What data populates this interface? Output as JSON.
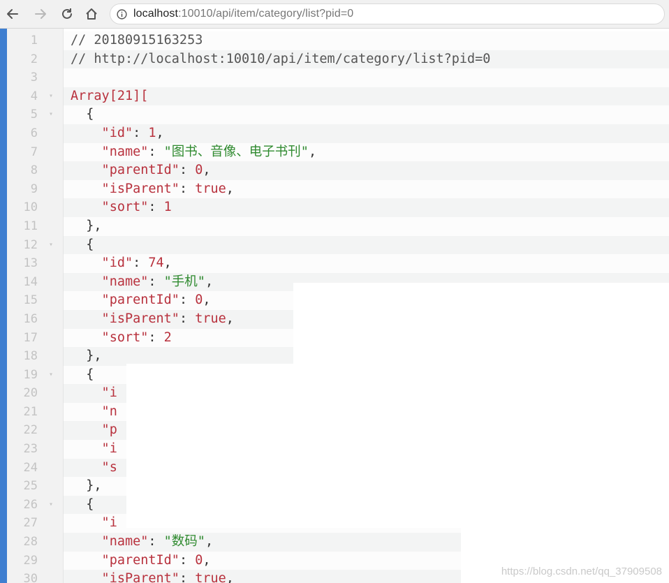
{
  "browser": {
    "url_host": "localhost",
    "url_rest": ":10010/api/item/category/list?pid=0",
    "icons": [
      "back-arrow-icon",
      "forward-arrow-icon",
      "reload-icon",
      "home-icon",
      "info-icon"
    ]
  },
  "viewer": {
    "lines": [
      {
        "n": "1",
        "fold": "",
        "parts": [
          {
            "t": "// 20180915163253",
            "c": "comment"
          }
        ]
      },
      {
        "n": "2",
        "fold": "",
        "parts": [
          {
            "t": "// http://localhost:10010/api/item/category/list?pid=0",
            "c": "comment"
          }
        ]
      },
      {
        "n": "3",
        "fold": "",
        "parts": []
      },
      {
        "n": "4",
        "fold": "▾",
        "parts": [
          {
            "t": "Array",
            "c": "type"
          },
          {
            "t": "[21][",
            "c": "type"
          }
        ]
      },
      {
        "n": "5",
        "fold": "▾",
        "parts": [
          {
            "t": "  {",
            "c": "punct"
          }
        ]
      },
      {
        "n": "6",
        "fold": "",
        "parts": [
          {
            "t": "    \"id\"",
            "c": "key"
          },
          {
            "t": ": ",
            "c": "punct"
          },
          {
            "t": "1",
            "c": "num"
          },
          {
            "t": ",",
            "c": "punct"
          }
        ]
      },
      {
        "n": "7",
        "fold": "",
        "parts": [
          {
            "t": "    \"name\"",
            "c": "key"
          },
          {
            "t": ": ",
            "c": "punct"
          },
          {
            "t": "\"图书、音像、电子书刊\"",
            "c": "str"
          },
          {
            "t": ",",
            "c": "punct"
          }
        ]
      },
      {
        "n": "8",
        "fold": "",
        "parts": [
          {
            "t": "    \"parentId\"",
            "c": "key"
          },
          {
            "t": ": ",
            "c": "punct"
          },
          {
            "t": "0",
            "c": "num"
          },
          {
            "t": ",",
            "c": "punct"
          }
        ]
      },
      {
        "n": "9",
        "fold": "",
        "parts": [
          {
            "t": "    \"isParent\"",
            "c": "key"
          },
          {
            "t": ": ",
            "c": "punct"
          },
          {
            "t": "true",
            "c": "bool"
          },
          {
            "t": ",",
            "c": "punct"
          }
        ]
      },
      {
        "n": "10",
        "fold": "",
        "parts": [
          {
            "t": "    \"sort\"",
            "c": "key"
          },
          {
            "t": ": ",
            "c": "punct"
          },
          {
            "t": "1",
            "c": "num"
          }
        ]
      },
      {
        "n": "11",
        "fold": "",
        "parts": [
          {
            "t": "  },",
            "c": "punct"
          }
        ]
      },
      {
        "n": "12",
        "fold": "▾",
        "parts": [
          {
            "t": "  {",
            "c": "punct"
          }
        ]
      },
      {
        "n": "13",
        "fold": "",
        "parts": [
          {
            "t": "    \"id\"",
            "c": "key"
          },
          {
            "t": ": ",
            "c": "punct"
          },
          {
            "t": "74",
            "c": "num"
          },
          {
            "t": ",",
            "c": "punct"
          }
        ]
      },
      {
        "n": "14",
        "fold": "",
        "parts": [
          {
            "t": "    \"name\"",
            "c": "key"
          },
          {
            "t": ": ",
            "c": "punct"
          },
          {
            "t": "\"手机\"",
            "c": "str"
          },
          {
            "t": ",",
            "c": "punct"
          }
        ]
      },
      {
        "n": "15",
        "fold": "",
        "parts": [
          {
            "t": "    \"parentId\"",
            "c": "key"
          },
          {
            "t": ": ",
            "c": "punct"
          },
          {
            "t": "0",
            "c": "num"
          },
          {
            "t": ",",
            "c": "punct"
          }
        ]
      },
      {
        "n": "16",
        "fold": "",
        "parts": [
          {
            "t": "    \"isParent\"",
            "c": "key"
          },
          {
            "t": ": ",
            "c": "punct"
          },
          {
            "t": "true",
            "c": "bool"
          },
          {
            "t": ",",
            "c": "punct"
          }
        ]
      },
      {
        "n": "17",
        "fold": "",
        "parts": [
          {
            "t": "    \"sort\"",
            "c": "key"
          },
          {
            "t": ": ",
            "c": "punct"
          },
          {
            "t": "2",
            "c": "num"
          }
        ]
      },
      {
        "n": "18",
        "fold": "",
        "parts": [
          {
            "t": "  },",
            "c": "punct"
          }
        ]
      },
      {
        "n": "19",
        "fold": "▾",
        "parts": [
          {
            "t": "  {",
            "c": "punct"
          }
        ]
      },
      {
        "n": "20",
        "fold": "",
        "parts": [
          {
            "t": "    \"i",
            "c": "key"
          }
        ]
      },
      {
        "n": "21",
        "fold": "",
        "parts": [
          {
            "t": "    \"n",
            "c": "key"
          }
        ]
      },
      {
        "n": "22",
        "fold": "",
        "parts": [
          {
            "t": "    \"p",
            "c": "key"
          }
        ]
      },
      {
        "n": "23",
        "fold": "",
        "parts": [
          {
            "t": "    \"i",
            "c": "key"
          }
        ]
      },
      {
        "n": "24",
        "fold": "",
        "parts": [
          {
            "t": "    \"s",
            "c": "key"
          }
        ]
      },
      {
        "n": "25",
        "fold": "",
        "parts": [
          {
            "t": "  },",
            "c": "punct"
          }
        ]
      },
      {
        "n": "26",
        "fold": "▾",
        "parts": [
          {
            "t": "  {",
            "c": "punct"
          }
        ]
      },
      {
        "n": "27",
        "fold": "",
        "parts": [
          {
            "t": "    \"i",
            "c": "key"
          }
        ]
      },
      {
        "n": "28",
        "fold": "",
        "parts": [
          {
            "t": "    \"name\"",
            "c": "key"
          },
          {
            "t": ": ",
            "c": "punct"
          },
          {
            "t": "\"数码\"",
            "c": "str"
          },
          {
            "t": ",",
            "c": "punct"
          }
        ]
      },
      {
        "n": "29",
        "fold": "",
        "parts": [
          {
            "t": "    \"parentId\"",
            "c": "key"
          },
          {
            "t": ": ",
            "c": "punct"
          },
          {
            "t": "0",
            "c": "num"
          },
          {
            "t": ",",
            "c": "punct"
          }
        ]
      },
      {
        "n": "30",
        "fold": "",
        "parts": [
          {
            "t": "    \"isParent\"",
            "c": "key"
          },
          {
            "t": ": ",
            "c": "punct"
          },
          {
            "t": "true",
            "c": "bool"
          },
          {
            "t": ",",
            "c": "punct"
          }
        ]
      }
    ]
  },
  "watermark": "https://blog.csdn.net/qq_37909508",
  "colors": {
    "accent_bar": "#3f7fd0",
    "key": "#b8313d",
    "string": "#2f8a2f"
  }
}
